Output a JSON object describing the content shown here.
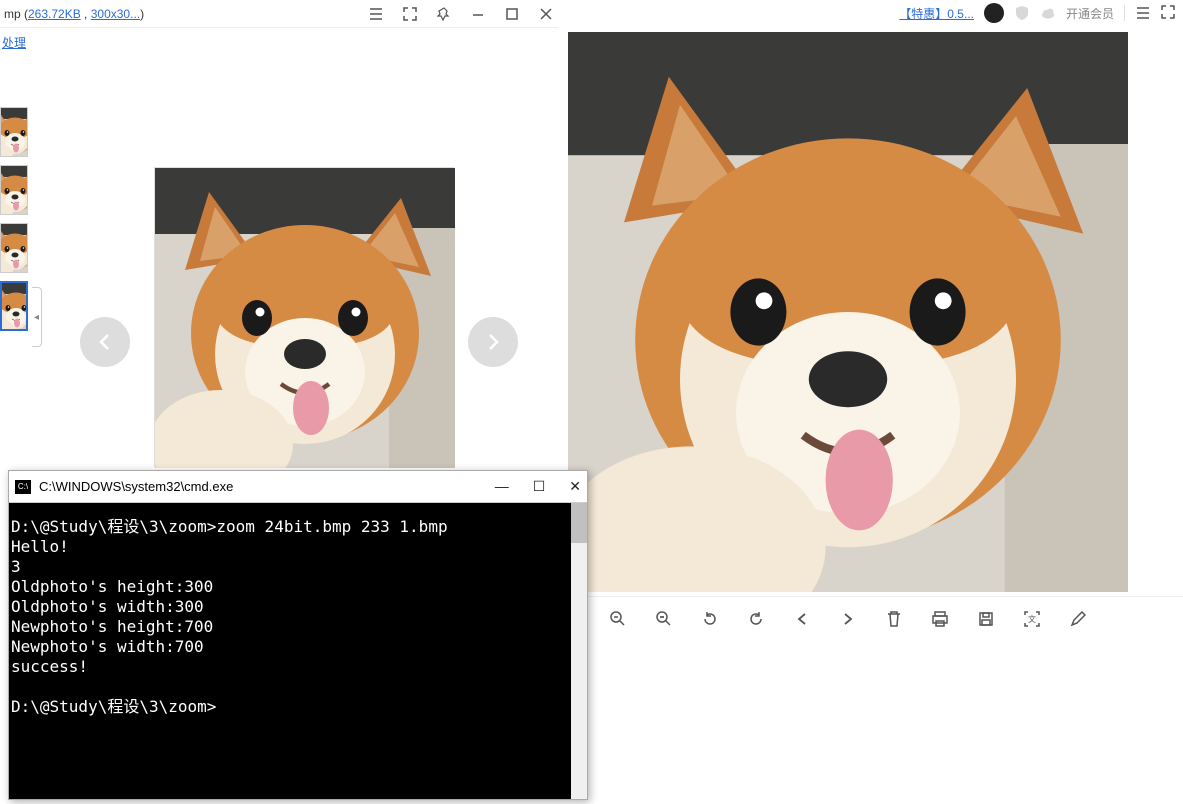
{
  "left_viewer": {
    "file_ext": "mp (",
    "file_size": "263.72KB",
    "file_sep": " , ",
    "file_dim": "300x30...",
    "file_close": ")",
    "linkbar": "处理",
    "thumbs_count": 4,
    "active_thumb_index": 3
  },
  "right_viewer": {
    "promo": "【特惠】0.5...",
    "vip_text": "开通会员"
  },
  "cmd": {
    "title": "C:\\WINDOWS\\system32\\cmd.exe",
    "lines": [
      "D:\\@Study\\程设\\3\\zoom>zoom 24bit.bmp 233 1.bmp",
      "Hello!",
      "3",
      "Oldphoto's height:300",
      "Oldphoto's width:300",
      "Newphoto's height:700",
      "Newphoto's width:700",
      "success!",
      "",
      "D:\\@Study\\程设\\3\\zoom>"
    ]
  }
}
